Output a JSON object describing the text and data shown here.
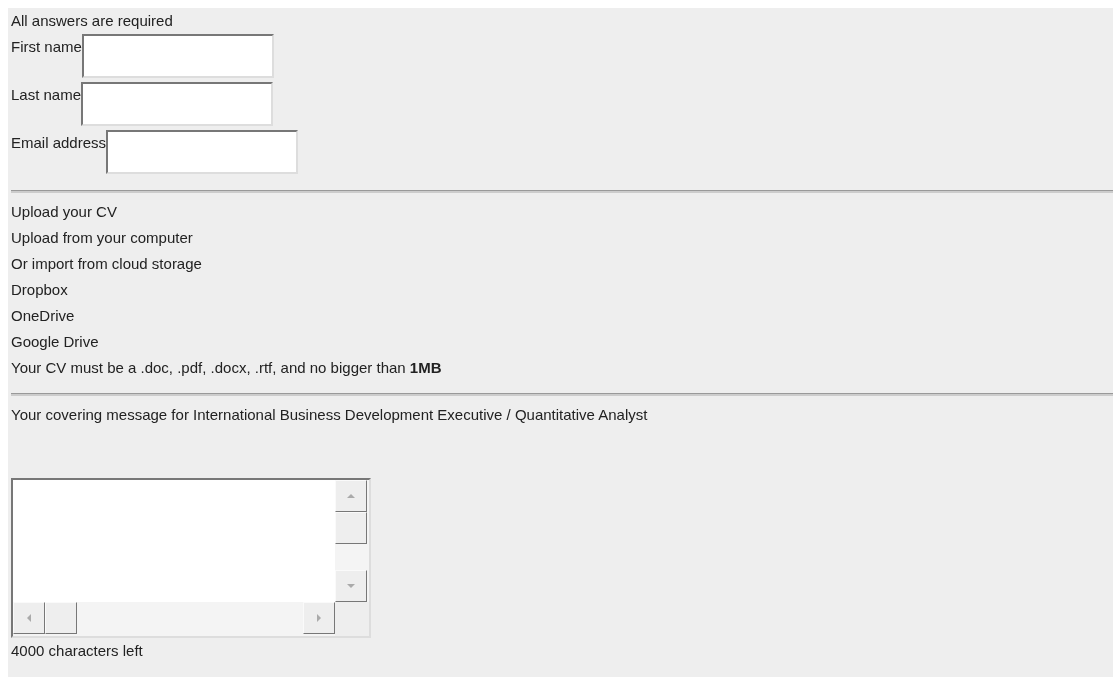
{
  "notice": "All answers are required",
  "fields": [
    {
      "label": "First name"
    },
    {
      "label": "Last name"
    },
    {
      "label": "Email address"
    }
  ],
  "upload": {
    "lines": [
      "Upload your CV",
      "Upload from your computer",
      "Or import from cloud storage",
      "Dropbox",
      "OneDrive",
      "Google Drive"
    ],
    "requirement": "Your CV must be a .doc, .pdf, .docx, .rtf, and no bigger than **1MB**"
  },
  "message": {
    "label": "Your covering message for International Business Development Executive / Quantitative Analyst",
    "counter": "4000 characters left"
  }
}
